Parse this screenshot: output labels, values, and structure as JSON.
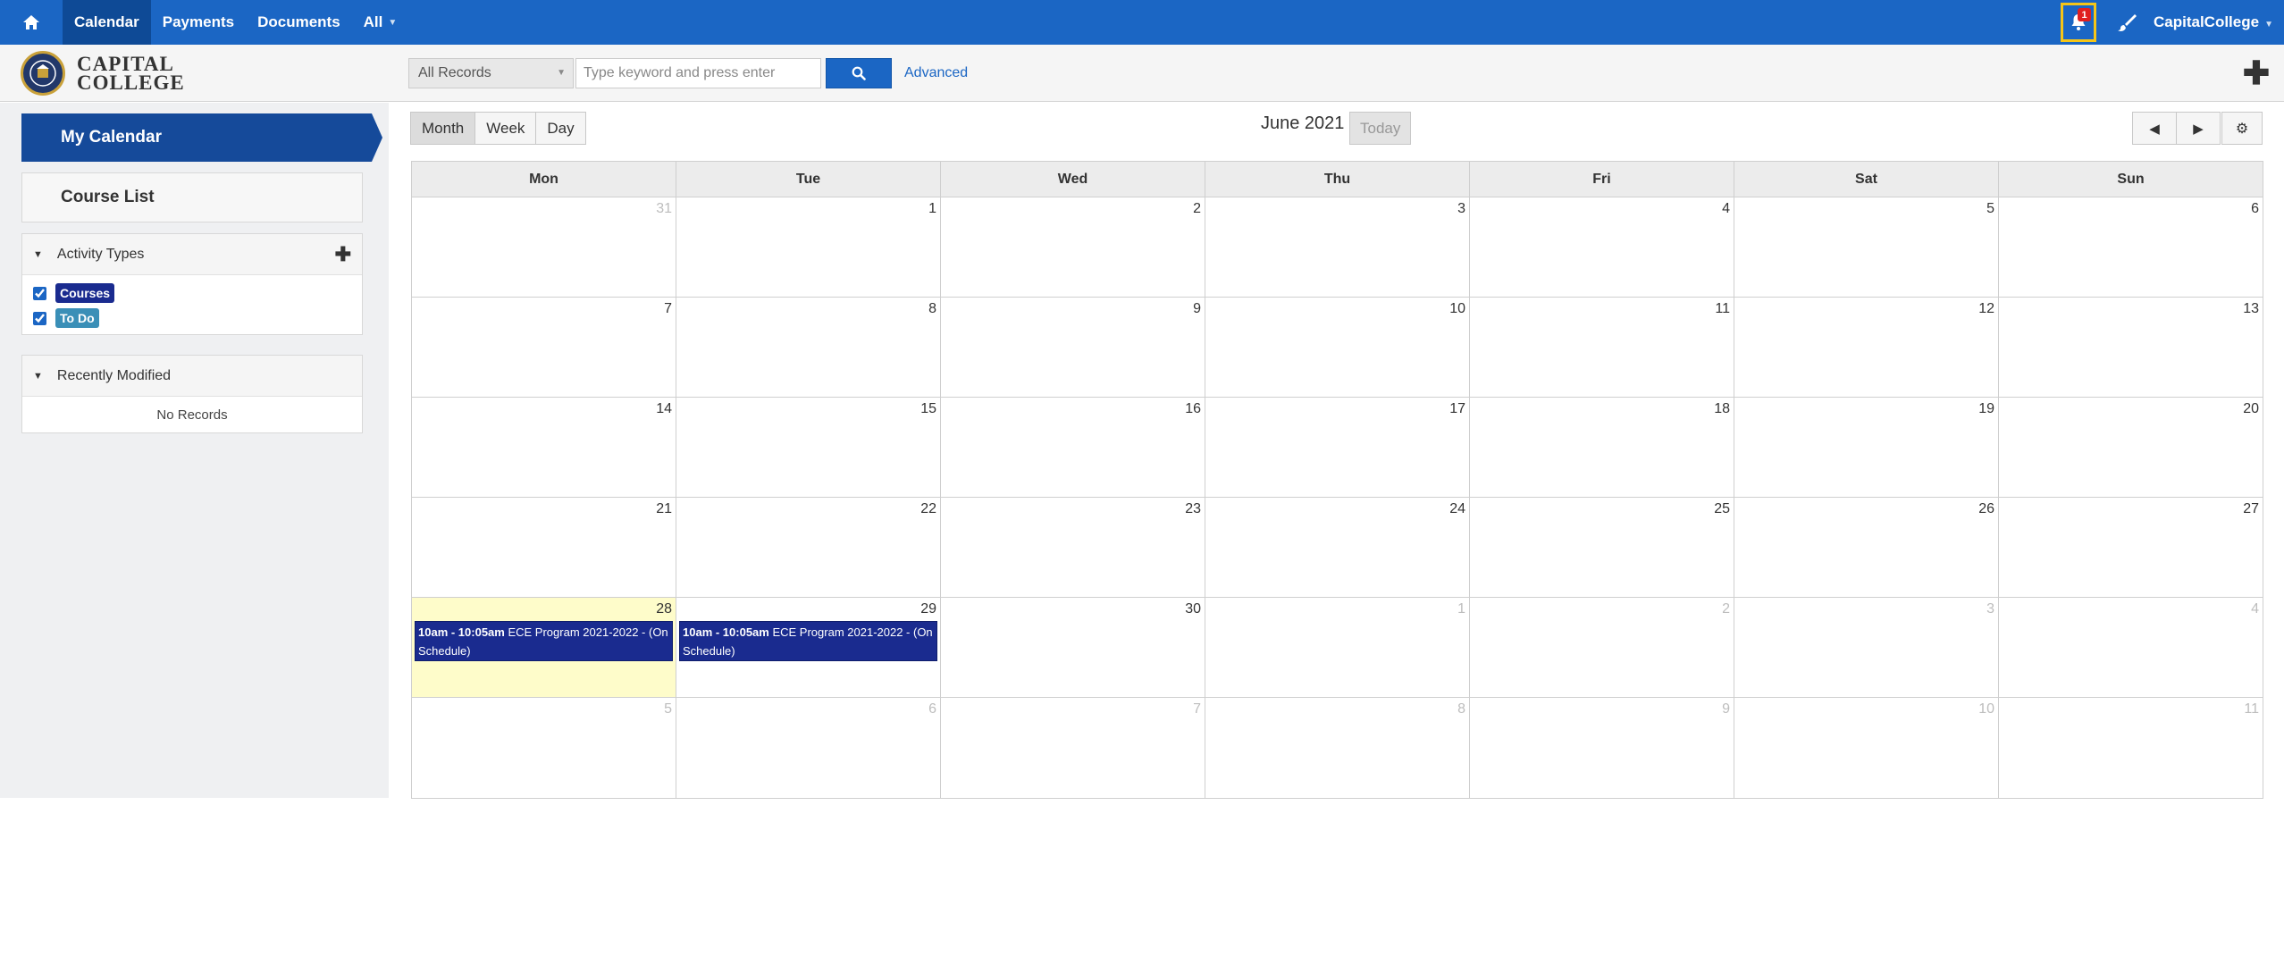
{
  "topnav": {
    "home_icon": "home-icon",
    "items": [
      {
        "label": "Calendar",
        "active": true
      },
      {
        "label": "Payments",
        "active": false
      },
      {
        "label": "Documents",
        "active": false
      },
      {
        "label": "All",
        "active": false
      }
    ],
    "notifications_count": "1",
    "bell_icon": "bell-icon",
    "brush_icon": "brush-icon",
    "user": "CapitalCollege",
    "accent_color": "#1b66c4",
    "highlight_color": "#f5c518"
  },
  "header": {
    "logo_line1": "CAPITAL",
    "logo_line2": "COLLEGE",
    "scope": "All Records",
    "search_placeholder": "Type keyword and press enter",
    "advanced_label": "Advanced",
    "search_icon": "search-icon",
    "add_icon": "plus-icon"
  },
  "sidebar": {
    "my_calendar": "My Calendar",
    "course_list": "Course List",
    "activity_types": {
      "title": "Activity Types",
      "items": [
        {
          "label": "Courses",
          "checked": true,
          "color": "#1a2b8f"
        },
        {
          "label": "To Do",
          "checked": true,
          "color": "#3a8fb7"
        }
      ]
    },
    "recently_modified": {
      "title": "Recently Modified",
      "empty": "No Records"
    }
  },
  "calendar": {
    "views": [
      "Month",
      "Week",
      "Day"
    ],
    "active_view": "Month",
    "title": "June 2021",
    "today_label": "Today",
    "prev": "◀",
    "next": "▶",
    "settings_icon": "gear-icon",
    "weekdays": [
      "Mon",
      "Tue",
      "Wed",
      "Thu",
      "Fri",
      "Sat",
      "Sun"
    ],
    "weeks": [
      [
        {
          "d": "31",
          "other": true
        },
        {
          "d": "1"
        },
        {
          "d": "2"
        },
        {
          "d": "3"
        },
        {
          "d": "4"
        },
        {
          "d": "5"
        },
        {
          "d": "6"
        }
      ],
      [
        {
          "d": "7"
        },
        {
          "d": "8"
        },
        {
          "d": "9"
        },
        {
          "d": "10"
        },
        {
          "d": "11"
        },
        {
          "d": "12"
        },
        {
          "d": "13"
        }
      ],
      [
        {
          "d": "14"
        },
        {
          "d": "15"
        },
        {
          "d": "16"
        },
        {
          "d": "17"
        },
        {
          "d": "18"
        },
        {
          "d": "19"
        },
        {
          "d": "20"
        }
      ],
      [
        {
          "d": "21"
        },
        {
          "d": "22"
        },
        {
          "d": "23"
        },
        {
          "d": "24"
        },
        {
          "d": "25"
        },
        {
          "d": "26"
        },
        {
          "d": "27"
        }
      ],
      [
        {
          "d": "28",
          "today": true,
          "event": {
            "time": "10am - 10:05am",
            "title": "ECE Program 2021-2022 - (On Schedule)"
          }
        },
        {
          "d": "29",
          "event": {
            "time": "10am - 10:05am",
            "title": "ECE Program 2021-2022 - (On Schedule)"
          }
        },
        {
          "d": "30"
        },
        {
          "d": "1",
          "other": true
        },
        {
          "d": "2",
          "other": true
        },
        {
          "d": "3",
          "other": true
        },
        {
          "d": "4",
          "other": true
        }
      ],
      [
        {
          "d": "5",
          "other": true
        },
        {
          "d": "6",
          "other": true
        },
        {
          "d": "7",
          "other": true
        },
        {
          "d": "8",
          "other": true
        },
        {
          "d": "9",
          "other": true
        },
        {
          "d": "10",
          "other": true
        },
        {
          "d": "11",
          "other": true
        }
      ]
    ]
  }
}
